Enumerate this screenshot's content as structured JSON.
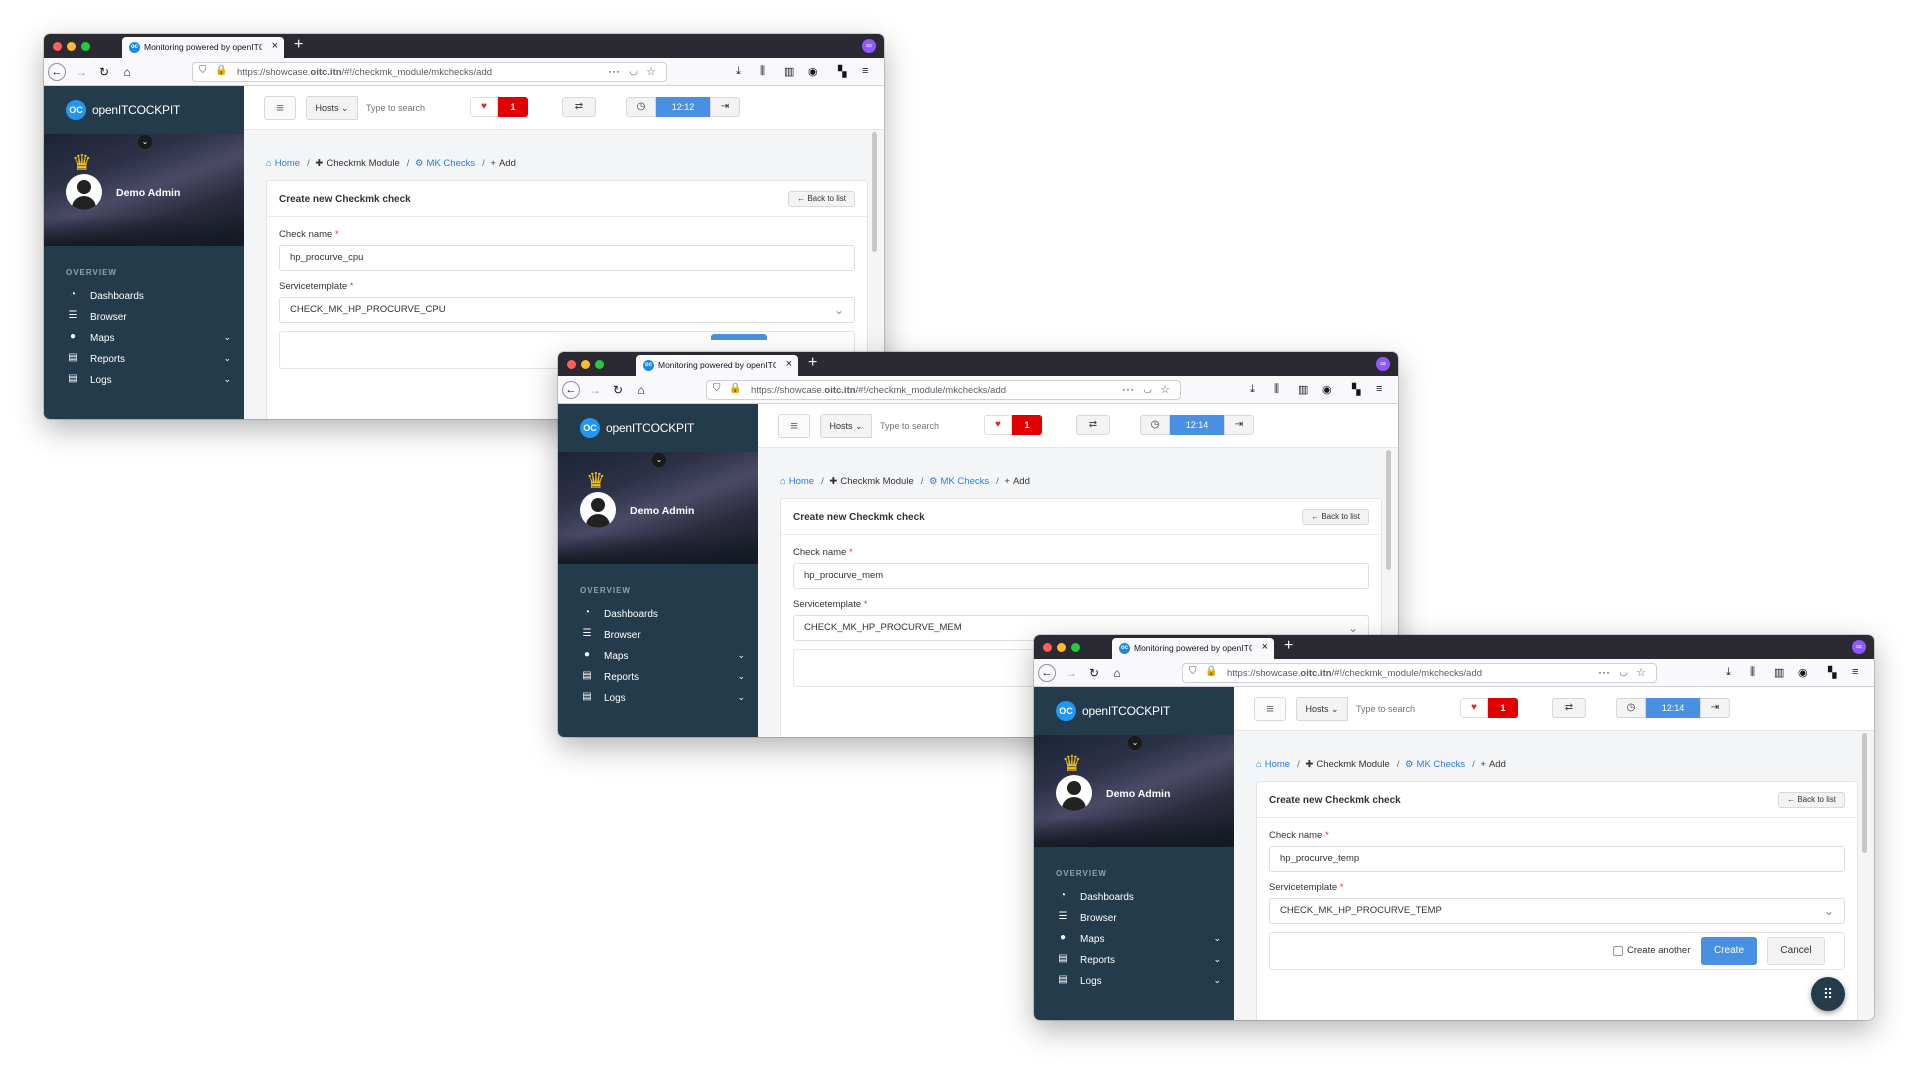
{
  "windows": [
    {
      "browser": {
        "tab_title": "Monitoring powered by openITC",
        "url_prefix": "https://showcase.",
        "url_host": "oitc.itn",
        "url_path": "/#!/checkmk_module/mkchecks/add"
      },
      "sidebar": {
        "brand": "openITCOCKPIT",
        "user_name": "Demo Admin",
        "section": "OVERVIEW",
        "items": [
          "Dashboards",
          "Browser",
          "Maps",
          "Reports",
          "Logs"
        ]
      },
      "topbar": {
        "hosts_label": "Hosts",
        "search_placeholder": "Type to search",
        "problem_count": "1",
        "clock": "12:12"
      },
      "breadcrumb": [
        "Home",
        "Checkmk Module",
        "MK Checks",
        "Add"
      ],
      "form": {
        "title": "Create new Checkmk check",
        "back_label": "Back to list",
        "check_name_label": "Check name",
        "check_name_value": "hp_procurve_cpu",
        "template_label": "Servicetemplate",
        "template_value": "CHECK_MK_HP_PROCURVE_CPU"
      }
    },
    {
      "browser": {
        "tab_title": "Monitoring powered by openITC",
        "url_prefix": "https://showcase.",
        "url_host": "oitc.itn",
        "url_path": "/#!/checkmk_module/mkchecks/add"
      },
      "sidebar": {
        "brand": "openITCOCKPIT",
        "user_name": "Demo Admin",
        "section": "OVERVIEW",
        "items": [
          "Dashboards",
          "Browser",
          "Maps",
          "Reports",
          "Logs"
        ]
      },
      "topbar": {
        "hosts_label": "Hosts",
        "search_placeholder": "Type to search",
        "problem_count": "1",
        "clock": "12:14"
      },
      "breadcrumb": [
        "Home",
        "Checkmk Module",
        "MK Checks",
        "Add"
      ],
      "form": {
        "title": "Create new Checkmk check",
        "back_label": "Back to list",
        "check_name_label": "Check name",
        "check_name_value": "hp_procurve_mem",
        "template_label": "Servicetemplate",
        "template_value": "CHECK_MK_HP_PROCURVE_MEM"
      }
    },
    {
      "browser": {
        "tab_title": "Monitoring powered by openITC",
        "url_prefix": "https://showcase.",
        "url_host": "oitc.itn",
        "url_path": "/#!/checkmk_module/mkchecks/add"
      },
      "sidebar": {
        "brand": "openITCOCKPIT",
        "user_name": "Demo Admin",
        "section": "OVERVIEW",
        "items": [
          "Dashboards",
          "Browser",
          "Maps",
          "Reports",
          "Logs"
        ]
      },
      "topbar": {
        "hosts_label": "Hosts",
        "search_placeholder": "Type to search",
        "problem_count": "1",
        "clock": "12:14"
      },
      "breadcrumb": [
        "Home",
        "Checkmk Module",
        "MK Checks",
        "Add"
      ],
      "form": {
        "title": "Create new Checkmk check",
        "back_label": "Back to list",
        "check_name_label": "Check name",
        "check_name_value": "hp_procurve_temp",
        "template_label": "Servicetemplate",
        "template_value": "CHECK_MK_HP_PROCURVE_TEMP",
        "create_another_label": "Create another",
        "create_label": "Create",
        "cancel_label": "Cancel"
      }
    }
  ],
  "icons": {
    "back": "arrow-left-icon",
    "forward": "arrow-right-icon",
    "reload": "reload-icon",
    "home": "home-icon",
    "heart": "heart-icon",
    "clock": "clock-icon",
    "crown": "crown-icon",
    "apps": "grid-icon"
  },
  "colors": {
    "sidebar": "#243b4c",
    "accent": "#4a90e2",
    "alert": "#e00000",
    "link": "#2b7de0"
  }
}
